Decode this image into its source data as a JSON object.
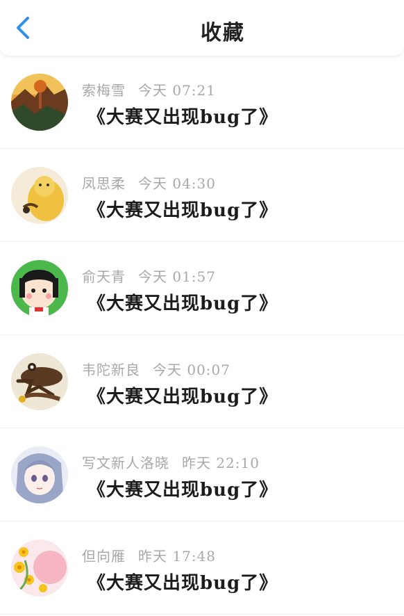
{
  "header": {
    "title": "收藏",
    "back_icon": "chevron-left-icon",
    "accent_color": "#2f8fe8"
  },
  "favorites": [
    {
      "author": "索梅雪",
      "time": "今天 07:21",
      "title": "《大赛又出现bug了》"
    },
    {
      "author": "凤思柔",
      "time": "今天 04:30",
      "title": "《大赛又出现bug了》"
    },
    {
      "author": "俞天青",
      "time": "今天 01:57",
      "title": "《大赛又出现bug了》"
    },
    {
      "author": "韦陀新良",
      "time": "今天 00:07",
      "title": "《大赛又出现bug了》"
    },
    {
      "author": "写文新人洛晓",
      "time": "昨天 22:10",
      "title": "《大赛又出现bug了》"
    },
    {
      "author": "但向雁",
      "time": "昨天 17:48",
      "title": "《大赛又出现bug了》"
    }
  ]
}
